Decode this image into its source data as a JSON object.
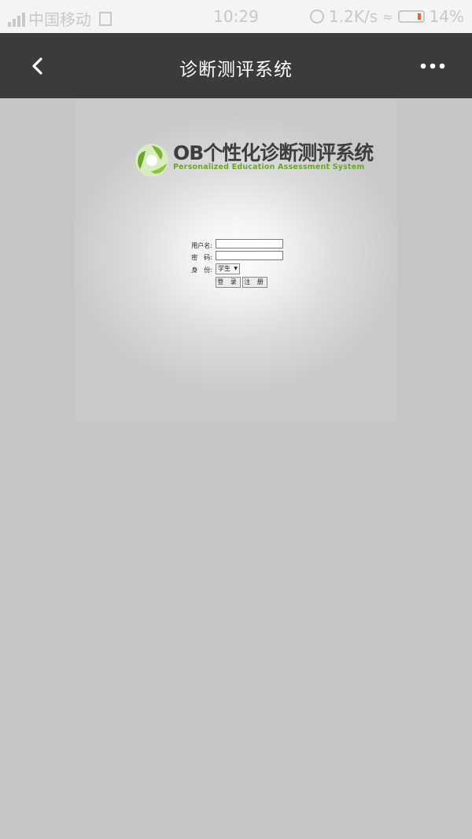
{
  "status_bar": {
    "carrier": "中国移动",
    "time": "10:29",
    "speed": "1.2K/s",
    "battery": "14%",
    "icons": [
      "signal-icon",
      "sim-icon",
      "alarm-icon",
      "wifi-icon",
      "battery-icon"
    ]
  },
  "nav": {
    "title": "诊断测评系统",
    "back_icon": "chevron-left-icon",
    "more_icon": "more-dots-icon"
  },
  "logo": {
    "title": "OB个性化诊断测评系统",
    "subtitle": "Personalized Education Assessment System",
    "accent_color": "#7ab531"
  },
  "login": {
    "username_label": "用户名:",
    "password_label": "密　码:",
    "role_label": "身　份:",
    "role_selected": "学生",
    "login_button": "登 录",
    "register_button": "注 册"
  },
  "colors": {
    "nav_background": "#3b3b3b",
    "page_background": "#c6c6c6",
    "status_bar_background": "#f4f4f4"
  }
}
